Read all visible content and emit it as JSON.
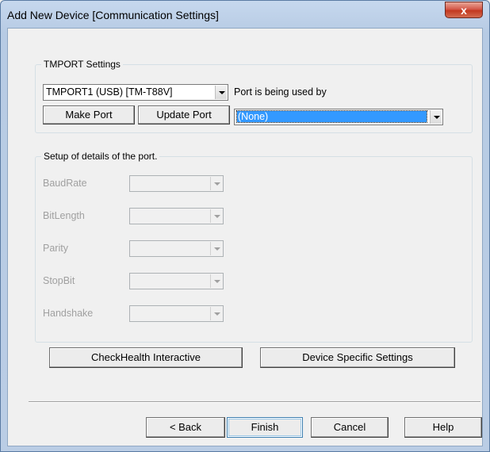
{
  "window": {
    "title": "Add New Device  [Communication Settings]",
    "close_glyph": "x"
  },
  "tmport": {
    "legend": "TMPORT Settings",
    "port_value": "TMPORT1 (USB) [TM-T88V]",
    "used_by_label": "Port is being used by",
    "make_port": "Make Port",
    "update_port": "Update Port",
    "used_by_value": "(None)"
  },
  "port_details": {
    "legend": "Setup of details of the port.",
    "fields": [
      {
        "label": "BaudRate",
        "value": ""
      },
      {
        "label": "BitLength",
        "value": ""
      },
      {
        "label": "Parity",
        "value": ""
      },
      {
        "label": "StopBit",
        "value": ""
      },
      {
        "label": "Handshake",
        "value": ""
      }
    ]
  },
  "actions": {
    "checkhealth": "CheckHealth Interactive",
    "device_specific": "Device Specific Settings"
  },
  "footer": {
    "back": "< Back",
    "finish": "Finish",
    "cancel": "Cancel",
    "help": "Help"
  }
}
